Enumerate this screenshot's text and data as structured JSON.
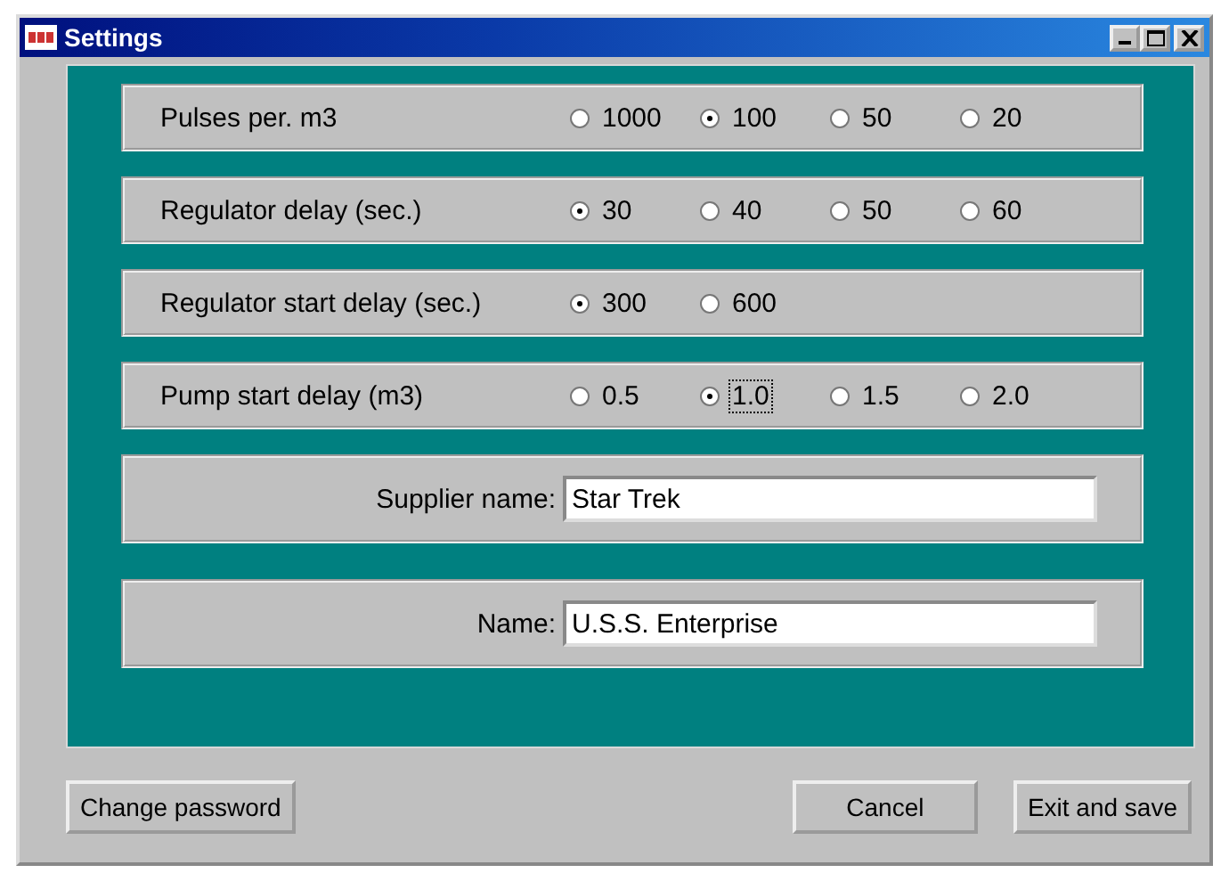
{
  "window": {
    "title": "Settings"
  },
  "radio_groups": [
    {
      "label": "Pulses per. m3",
      "options": [
        {
          "label": "1000",
          "selected": false,
          "focused": false
        },
        {
          "label": "100",
          "selected": true,
          "focused": false
        },
        {
          "label": "50",
          "selected": false,
          "focused": false
        },
        {
          "label": "20",
          "selected": false,
          "focused": false
        }
      ]
    },
    {
      "label": "Regulator delay (sec.)",
      "options": [
        {
          "label": "30",
          "selected": true,
          "focused": false
        },
        {
          "label": "40",
          "selected": false,
          "focused": false
        },
        {
          "label": "50",
          "selected": false,
          "focused": false
        },
        {
          "label": "60",
          "selected": false,
          "focused": false
        }
      ]
    },
    {
      "label": "Regulator start delay (sec.)",
      "options": [
        {
          "label": "300",
          "selected": true,
          "focused": false
        },
        {
          "label": "600",
          "selected": false,
          "focused": false
        }
      ]
    },
    {
      "label": "Pump start delay (m3)",
      "options": [
        {
          "label": "0.5",
          "selected": false,
          "focused": false
        },
        {
          "label": "1.0",
          "selected": true,
          "focused": true
        },
        {
          "label": "1.5",
          "selected": false,
          "focused": false
        },
        {
          "label": "2.0",
          "selected": false,
          "focused": false
        }
      ]
    }
  ],
  "fields": [
    {
      "label": "Supplier name:",
      "value": "Star Trek"
    },
    {
      "label": "Name:",
      "value": "U.S.S. Enterprise"
    }
  ],
  "buttons": [
    {
      "label": "Change password",
      "kind": "left"
    },
    {
      "label": "Cancel",
      "kind": "right"
    },
    {
      "label": "Exit and save",
      "kind": "right"
    }
  ]
}
